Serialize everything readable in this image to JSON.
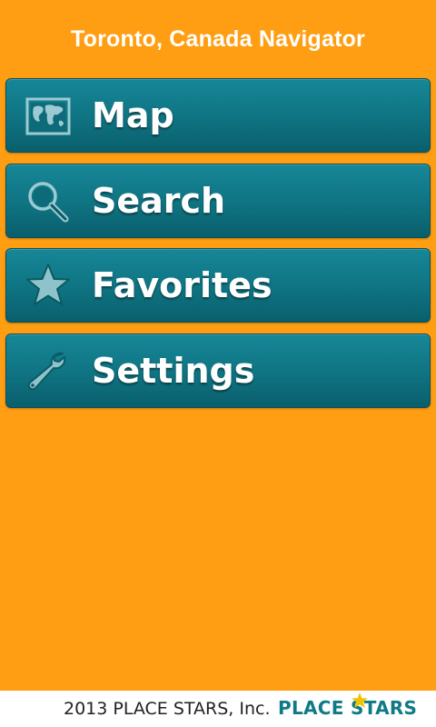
{
  "app": {
    "title": "Toronto, Canada Navigator"
  },
  "menu": {
    "items": [
      {
        "label": "Map",
        "icon": "map-icon"
      },
      {
        "label": "Search",
        "icon": "search-icon"
      },
      {
        "label": "Favorites",
        "icon": "star-icon"
      },
      {
        "label": "Settings",
        "icon": "wrench-icon"
      }
    ]
  },
  "footer": {
    "copyright": "2013 PLACE STARS, Inc.",
    "brand": "PLACE STARS"
  },
  "colors": {
    "background": "#FF9E12",
    "button": "#0F7382",
    "icon_fill": "#8FC3CC",
    "brand": "#0E7A86",
    "brand_star": "#F2C200"
  }
}
